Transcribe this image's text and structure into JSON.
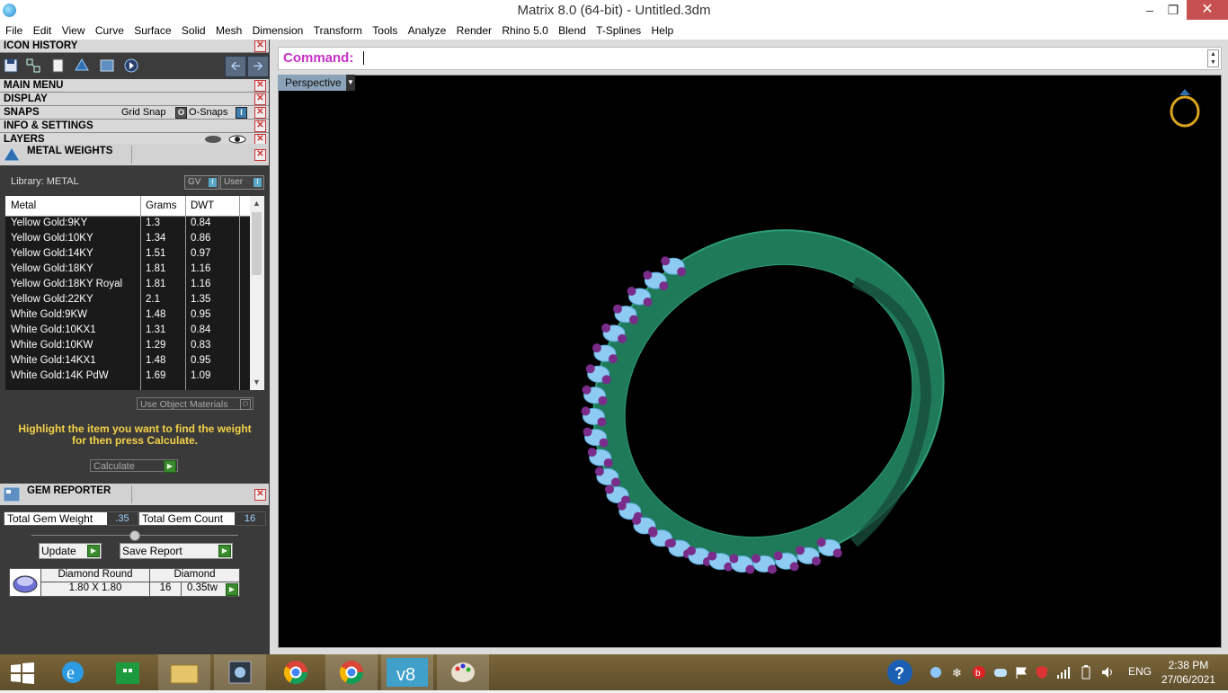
{
  "window": {
    "title": "Matrix 8.0 (64-bit) - Untitled.3dm",
    "minimize": "‒",
    "restore": "❐",
    "close": "✕"
  },
  "menu": [
    "File",
    "Edit",
    "View",
    "Curve",
    "Surface",
    "Solid",
    "Mesh",
    "Dimension",
    "Transform",
    "Tools",
    "Analyze",
    "Render",
    "Rhino 5.0",
    "Blend",
    "T-Splines",
    "Help"
  ],
  "panels": {
    "icon_history": "ICON HISTORY",
    "main_menu": "MAIN MENU",
    "display": "DISPLAY",
    "snaps": "SNAPS",
    "grid_snap": "Grid Snap",
    "o_snaps": "O-Snaps",
    "info_settings": "INFO & SETTINGS",
    "layers": "LAYERS",
    "close": "✕"
  },
  "metal_weights": {
    "title": "METAL WEIGHTS",
    "library": "Library: METAL",
    "gv": "GV",
    "user": "User",
    "columns": [
      "Metal",
      "Grams",
      "DWT"
    ],
    "rows": [
      [
        "Yellow Gold:9KY",
        "1.3",
        "0.84"
      ],
      [
        "Yellow Gold:10KY",
        "1.34",
        "0.86"
      ],
      [
        "Yellow Gold:14KY",
        "1.51",
        "0.97"
      ],
      [
        "Yellow Gold:18KY",
        "1.81",
        "1.16"
      ],
      [
        "Yellow Gold:18KY Royal",
        "1.81",
        "1.16"
      ],
      [
        "Yellow Gold:22KY",
        "2.1",
        "1.35"
      ],
      [
        "White Gold:9KW",
        "1.48",
        "0.95"
      ],
      [
        "White Gold:10KX1",
        "1.31",
        "0.84"
      ],
      [
        "White Gold:10KW",
        "1.29",
        "0.83"
      ],
      [
        "White Gold:14KX1",
        "1.48",
        "0.95"
      ],
      [
        "White Gold:14K PdW",
        "1.69",
        "1.09"
      ]
    ],
    "use_materials": "Use Object Materials",
    "hint_line1": "Highlight the item you want to find the weight",
    "hint_line2": "for then press Calculate.",
    "calculate": "Calculate"
  },
  "gem_reporter": {
    "title": "GEM REPORTER",
    "total_weight_label": "Total Gem Weight",
    "total_weight": ".35",
    "total_count_label": "Total Gem Count",
    "total_count": "16",
    "update": "Update",
    "save_report": "Save Report",
    "gem_name": "Diamond Round",
    "gem_type": "Diamond",
    "gem_size": "1.80 X 1.80",
    "gem_count": "16",
    "gem_weight": "0.35tw"
  },
  "command": {
    "label": "Command:",
    "value": ""
  },
  "viewport": {
    "name": "Perspective"
  },
  "taskbar": {
    "language": "ENG",
    "time": "2:38 PM",
    "date": "27/06/2021"
  },
  "colors": {
    "accent_command": "#c830c8",
    "hint_yellow": "#f4d148",
    "ring_green": "#1f7a5a",
    "gem_blue": "#8ecbf2",
    "prong_purple": "#7a2c8a"
  }
}
